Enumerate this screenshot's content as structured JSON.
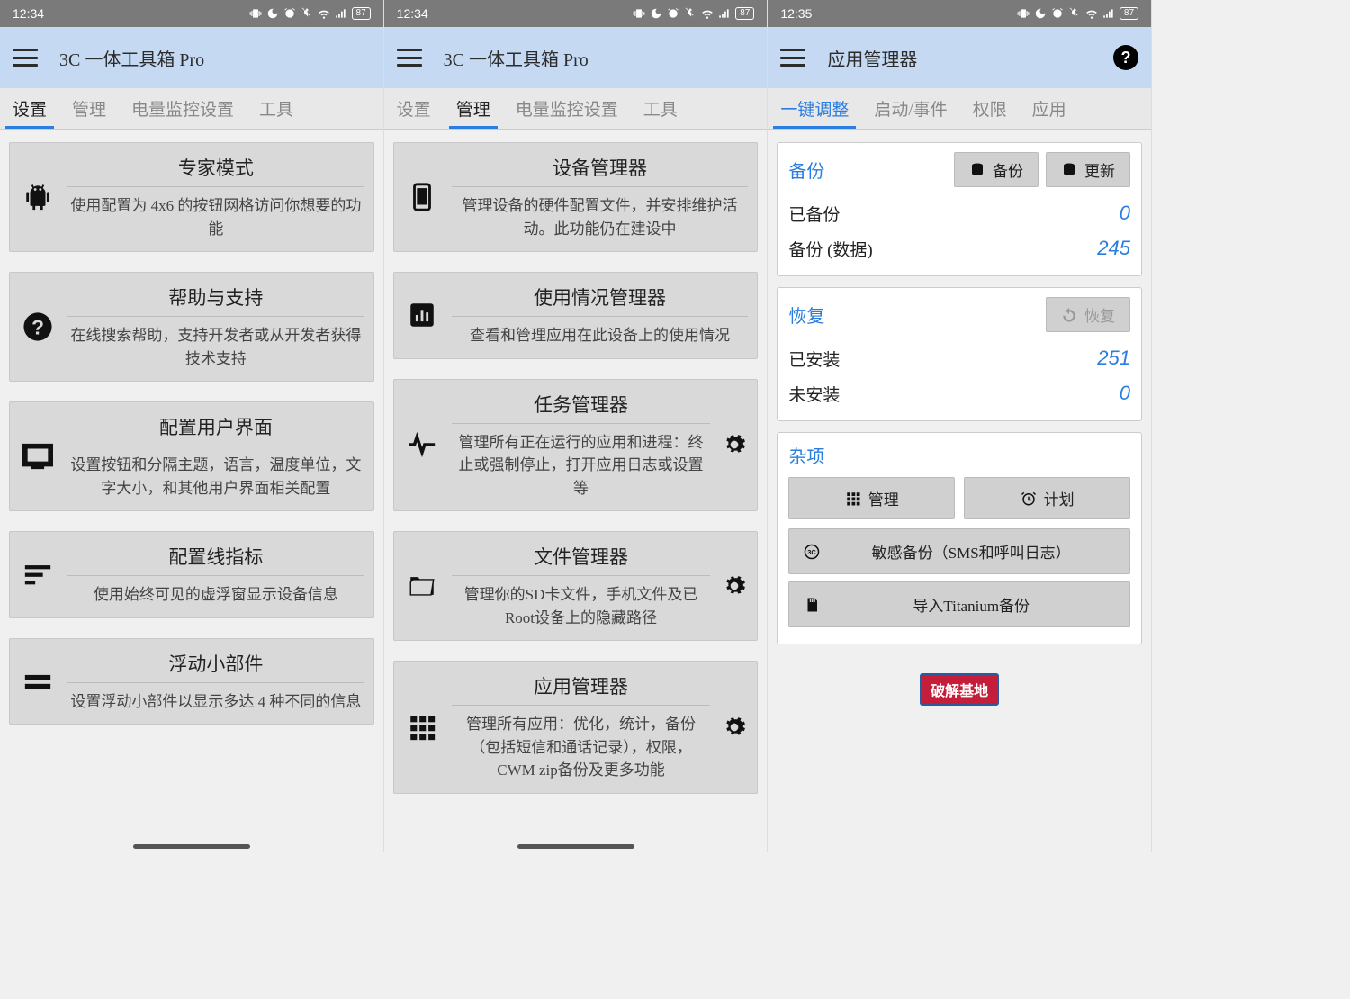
{
  "status": {
    "time1": "12:34",
    "time2": "12:34",
    "time3": "12:35",
    "battery": "87"
  },
  "col1": {
    "title": "3C 一体工具箱 Pro",
    "tabs": [
      "设置",
      "管理",
      "电量监控设置",
      "工具"
    ],
    "active_tab": 0,
    "items": [
      {
        "icon": "android",
        "title": "专家模式",
        "desc": "使用配置为 4x6 的按钮网格访问你想要的功能"
      },
      {
        "icon": "help",
        "title": "帮助与支持",
        "desc": "在线搜索帮助，支持开发者或从开发者获得技术支持"
      },
      {
        "icon": "display",
        "title": "配置用户界面",
        "desc": "设置按钮和分隔主题，语言，温度单位，文字大小，和其他用户界面相关配置"
      },
      {
        "icon": "lines",
        "title": "配置线指标",
        "desc": "使用始终可见的虚浮窗显示设备信息"
      },
      {
        "icon": "equals",
        "title": "浮动小部件",
        "desc": "设置浮动小部件以显示多达 4 种不同的信息"
      }
    ]
  },
  "col2": {
    "title": "3C 一体工具箱 Pro",
    "tabs": [
      "设置",
      "管理",
      "电量监控设置",
      "工具"
    ],
    "active_tab": 1,
    "items": [
      {
        "icon": "phone",
        "title": "设备管理器",
        "desc": "管理设备的硬件配置文件，并安排维护活动。此功能仍在建设中",
        "gear": false
      },
      {
        "icon": "bars",
        "title": "使用情况管理器",
        "desc": "查看和管理应用在此设备上的使用情况",
        "gear": false
      },
      {
        "icon": "pulse",
        "title": "任务管理器",
        "desc": "管理所有正在运行的应用和进程：终止或强制停止，打开应用日志或设置等",
        "gear": true
      },
      {
        "icon": "folder",
        "title": "文件管理器",
        "desc": "管理你的SD卡文件，手机文件及已Root设备上的隐藏路径",
        "gear": true
      },
      {
        "icon": "grid",
        "title": "应用管理器",
        "desc": "管理所有应用：优化，统计，备份（包括短信和通话记录），权限，CWM zip备份及更多功能",
        "gear": true
      }
    ]
  },
  "col3": {
    "title": "应用管理器",
    "tabs": [
      "一键调整",
      "启动/事件",
      "权限",
      "应用"
    ],
    "active_tab": 0,
    "backup": {
      "title": "备份",
      "btn_backup": "备份",
      "btn_update": "更新",
      "row1_label": "已备份",
      "row1_val": "0",
      "row2_label": "备份 (数据)",
      "row2_val": "245"
    },
    "restore": {
      "title": "恢复",
      "btn_restore": "恢复",
      "row1_label": "已安装",
      "row1_val": "251",
      "row2_label": "未安装",
      "row2_val": "0"
    },
    "misc": {
      "title": "杂项",
      "btn_manage": "管理",
      "btn_schedule": "计划",
      "btn_sensitive": "敏感备份（SMS和呼叫日志）",
      "btn_titanium": "导入Titanium备份"
    },
    "logo": "破解基地"
  }
}
